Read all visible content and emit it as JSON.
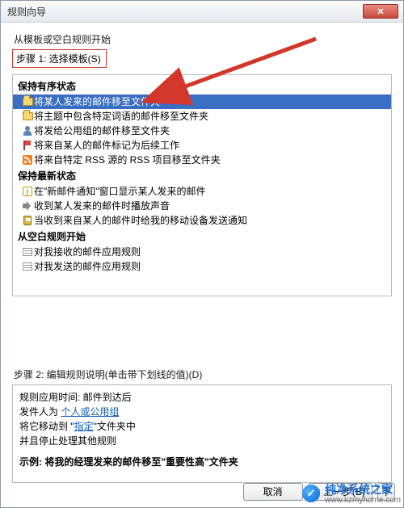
{
  "title": "规则向导",
  "intro": "从模板或空白规则开始",
  "step1_label": "步骤 1: 选择模板(S)",
  "groups": [
    {
      "header": "保持有序状态",
      "items": [
        {
          "icon": "folder",
          "label": "将某人发来的邮件移至文件夹",
          "selected": true
        },
        {
          "icon": "folder",
          "label": "将主题中包含特定词语的邮件移至文件夹"
        },
        {
          "icon": "people",
          "label": "将发给公用组的邮件移至文件夹"
        },
        {
          "icon": "flag",
          "label": "将来自某人的邮件标记为后续工作"
        },
        {
          "icon": "rss",
          "label": "将来自特定 RSS 源的 RSS 项目移至文件夹"
        }
      ]
    },
    {
      "header": "保持最新状态",
      "items": [
        {
          "icon": "alert",
          "label": "在\"新邮件通知\"窗口显示某人发来的邮件"
        },
        {
          "icon": "sound",
          "label": "收到某人发来的邮件时播放声音"
        },
        {
          "icon": "phone",
          "label": "当收到来自某人的邮件时给我的移动设备发送通知"
        }
      ]
    },
    {
      "header": "从空白规则开始",
      "items": [
        {
          "icon": "rule",
          "label": "对我接收的邮件应用规则"
        },
        {
          "icon": "rule",
          "label": "对我发送的邮件应用规则"
        }
      ]
    }
  ],
  "step2_label": "步骤 2: 编辑规则说明(单击带下划线的值)(D)",
  "description": {
    "line1_pre": "规则应用时间: ",
    "line1_post": "邮件到达后",
    "line2_pre": "发件人为 ",
    "line2_link": "个人或公用组",
    "line3_pre": "将它移动到 \"",
    "line3_link": "指定",
    "line3_post": "\"文件夹中",
    "line4": "并且停止处理其他规则",
    "example": "示例: 将我的经理发来的邮件移至\"重要性高\"文件夹"
  },
  "buttons": {
    "cancel": "取消",
    "back": "< 上一步(B)",
    "next": "下"
  },
  "watermark": {
    "badge": "✓",
    "main": "纯净系统之家",
    "sub": "www.kzmyhome.com"
  }
}
